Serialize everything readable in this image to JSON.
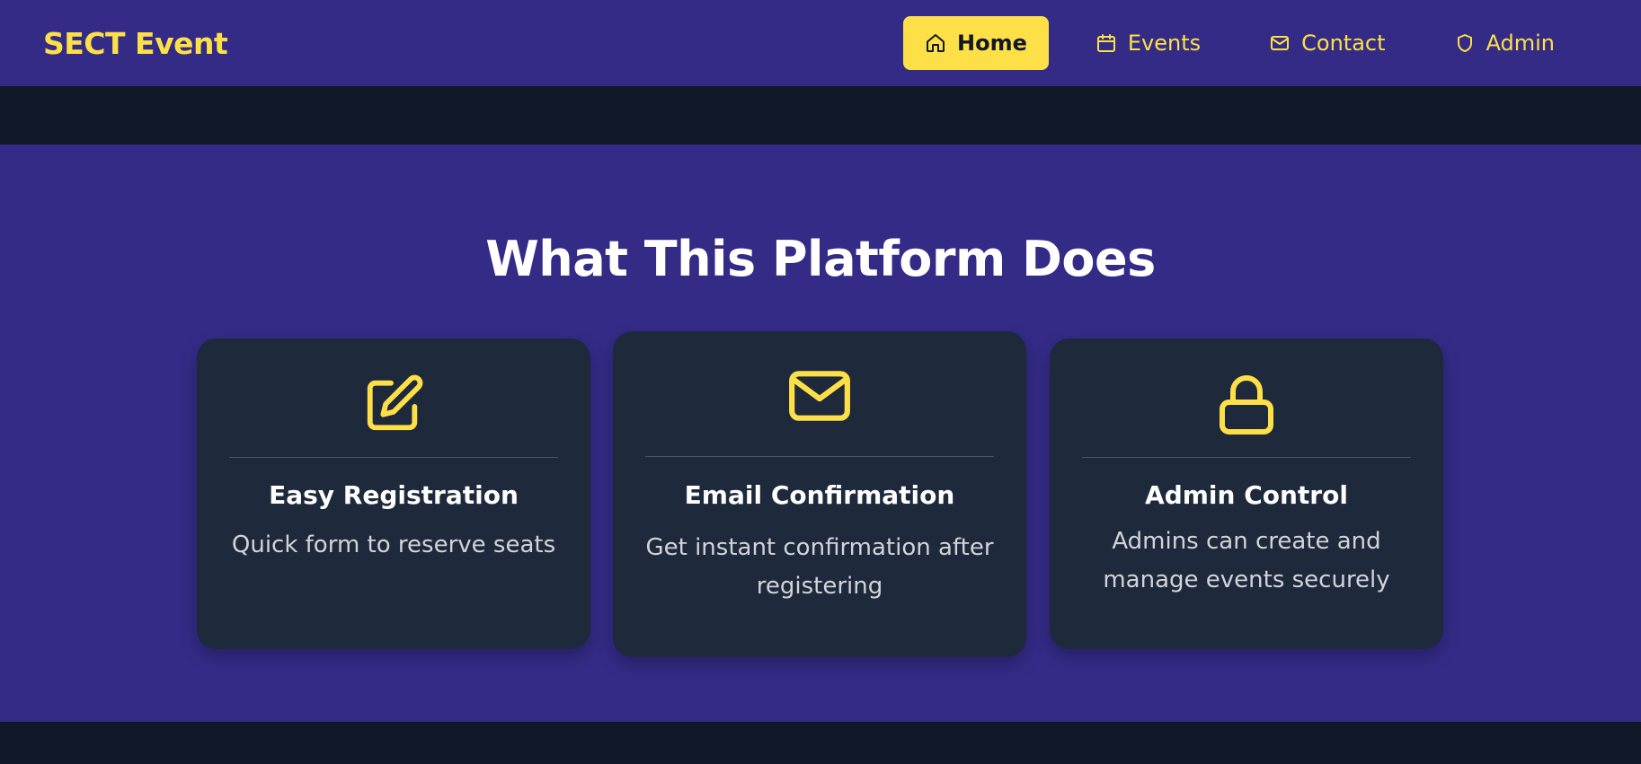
{
  "brand": {
    "name": "SECT Event"
  },
  "nav": {
    "items": [
      {
        "label": "Home",
        "icon": "home-icon",
        "active": true
      },
      {
        "label": "Events",
        "icon": "calendar-icon",
        "active": false
      },
      {
        "label": "Contact",
        "icon": "mail-icon",
        "active": false
      },
      {
        "label": "Admin",
        "icon": "shield-icon",
        "active": false
      }
    ]
  },
  "features": {
    "title": "What This Platform Does",
    "cards": [
      {
        "icon": "edit-icon",
        "title": "Easy Registration",
        "description": "Quick form to reserve seats"
      },
      {
        "icon": "mail-icon",
        "title": "Email Confirmation",
        "description": "Get instant confirmation after registering"
      },
      {
        "icon": "lock-icon",
        "title": "Admin Control",
        "description": "Admins can create and manage events securely"
      }
    ]
  },
  "colors": {
    "accent": "#fde047",
    "header_bg": "#342b87",
    "dark_bg": "#111827",
    "card_bg": "#1e293b"
  }
}
